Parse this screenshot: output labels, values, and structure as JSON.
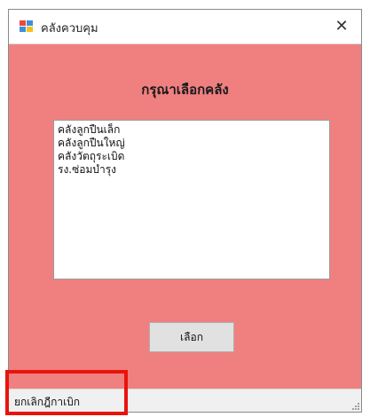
{
  "window": {
    "title": "คลังควบคุม",
    "close_symbol": "✕"
  },
  "main": {
    "heading": "กรุณาเลือกคลัง",
    "list_items": [
      "คลังลูกปืนเล็ก",
      "คลังลูกปืนใหญ่",
      "คลังวัตถุระเบิด",
      "รง.ซ่อมบำรุง"
    ],
    "select_button_label": "เลือก"
  },
  "statusbar": {
    "label": "ยกเลิกฎีกาเบิก"
  },
  "colors": {
    "window_background": "#f08080",
    "highlight_border": "#e8140c"
  },
  "icons": {
    "app": "app-icon",
    "close": "close-icon",
    "grip": "resize-grip-icon"
  }
}
